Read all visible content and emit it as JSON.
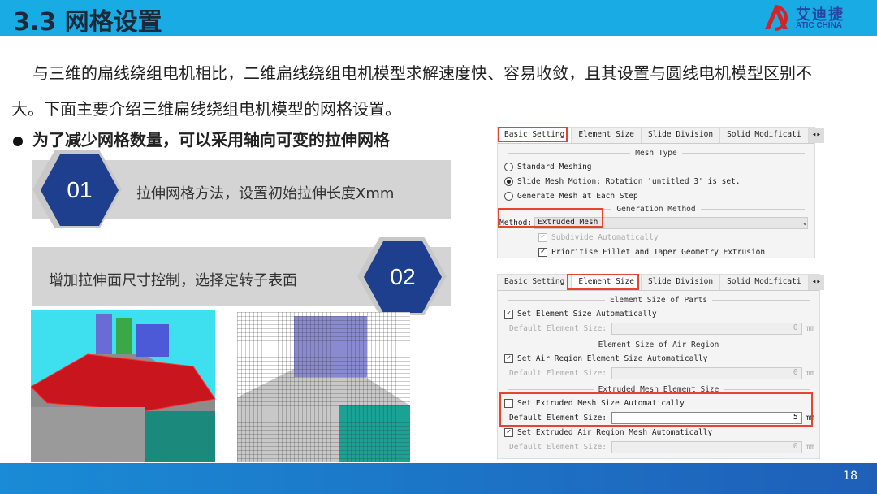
{
  "header": {
    "title": "3.3 网格设置",
    "logo_cn": "艾迪捷",
    "logo_en": "ATIC CHINA"
  },
  "intro": "与三维的扁线绕组电机相比，二维扁线绕组电机模型求解速度快、容易收敛，且其设置与圆线电机模型区别不大。下面主要介绍三维扁线绕组电机模型的网格设置。",
  "bullet": "为了减少网格数量，可以采用轴向可变的拉伸网格",
  "steps": [
    {
      "num": "01",
      "text": "拉伸网格方法，设置初始拉伸长度Xmm"
    },
    {
      "num": "02",
      "text": "增加拉伸面尺寸控制，选择定转子表面"
    }
  ],
  "tabs": [
    "Basic Setting",
    "Element Size",
    "Slide Division",
    "Solid Modificati"
  ],
  "dialog1": {
    "mesh_type": "Mesh Type",
    "options": [
      "Standard Meshing",
      "Slide Mesh Motion: Rotation 'untitled 3' is set.",
      "Generate Mesh at Each Step"
    ],
    "selected": 1,
    "gen_method": "Generation Method",
    "method_label": "Method:",
    "method_value": "Extruded Mesh",
    "subdivide": "Subdivide Automatically",
    "prioritise": "Prioritise Fillet and Taper Geometry Extrusion"
  },
  "dialog2": {
    "sec1": "Element Size of Parts",
    "auto1": "Set Element Size Automatically",
    "default_label": "Default Element Size:",
    "val1": "0",
    "unit": "mm",
    "sec2": "Element Size of Air Region",
    "auto2": "Set Air Region Element Size Automatically",
    "val2": "0",
    "sec3": "Extruded Mesh Element Size",
    "auto3": "Set Extruded Mesh Size Automatically",
    "val3": "5",
    "auto4": "Set Extruded Air Region Mesh Automatically",
    "val4": "0"
  },
  "footer": {
    "page": "18"
  },
  "colors": {
    "header": "#19ace4",
    "accent": "#1e3f8e",
    "highlight": "#e8432e"
  }
}
